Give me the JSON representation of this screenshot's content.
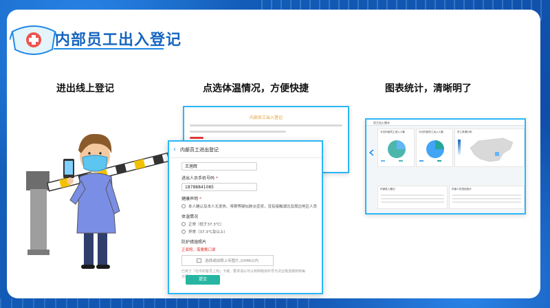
{
  "header": {
    "title": "内部员工出入登记"
  },
  "captions": [
    "进出线上登记",
    "点选体温情况，方便快捷",
    "图表统计，清晰明了"
  ],
  "back_form": {
    "title": "内部员工出入登记"
  },
  "form": {
    "title": "内部员工进出登记",
    "name_value": "王旭辉",
    "phone_label": "进出人员手机号码",
    "phone_value": "18788841085",
    "required_mark": "*",
    "health_label": "健康声明",
    "health_option": "本人确认及本人无发热、咳嗽等疑似肺炎症状，没有接触湖北及周边地区人员",
    "temp_label": "体温情况",
    "temp_normal": "正常（低于37.3℃）",
    "temp_abnormal": "异常（37.3℃及以上）",
    "photo_label": "防护措施照片",
    "photo_note": "正面照，需要戴口罩",
    "upload_text": "选择或拍照上传图片,20MB以内",
    "hint": "已到了「社中的客员上岗」卡被，要求请以可以到网络资料号与法业物流做到到每日要的。",
    "submit_label": "提交"
  },
  "dashboard": {
    "title": "员工出入统计",
    "panel1": "今日内部员工进入人数",
    "panel2": "今日内部员工出入人数",
    "panel3": "员工来源分布",
    "panel4": "外部进入登记",
    "panel5": "外部人员进出统计"
  },
  "colors": {
    "brand": "#1565c0",
    "accent": "#29b6f6",
    "submit": "#26b5a1",
    "warning": "#e53935"
  }
}
